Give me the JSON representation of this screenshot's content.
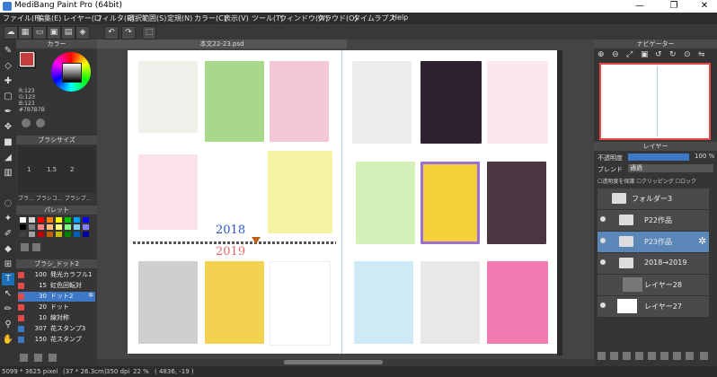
{
  "window": {
    "title": "MediBang Paint Pro (64bit)",
    "min": "—",
    "max": "❐",
    "close": "✕"
  },
  "menu": [
    "ファイル(F)",
    "編集(E)",
    "レイヤー(L)",
    "フィルタ(R)",
    "選択範囲(S)",
    "定規(N)",
    "カラー(C)",
    "表示(V)",
    "ツール(T)",
    "ウィンドウ(W)",
    "クラウド(O)",
    "タイムラプス",
    "Help"
  ],
  "toolbar": {
    "undo": "↶",
    "redo": "↷",
    "deselect": "⬚"
  },
  "panels": {
    "color": {
      "title": "カラー",
      "r": "R:123",
      "g": "G:123",
      "b": "B:123",
      "hex": "#7B7B7B"
    },
    "brush_size": {
      "title": "ブラシサイズ",
      "sizes": [
        "1",
        "1.5",
        "2"
      ],
      "footer": "ブラ… ブラシコ… ブラシプ…"
    },
    "palette": {
      "title": "パレット",
      "colors": [
        "#ffffff",
        "#d8d8d8",
        "#ff0000",
        "#ff8000",
        "#ffff00",
        "#00c000",
        "#00a0ff",
        "#0000ff",
        "#000000",
        "#808080",
        "#ff8080",
        "#ffc080",
        "#ffff80",
        "#80ff80",
        "#80d0ff",
        "#8080ff",
        "#404040",
        "#a0a0a0",
        "#c00000",
        "#c06000",
        "#c0c000",
        "#008000",
        "#0060c0",
        "#0000a0"
      ]
    },
    "brush_dots": {
      "title": "ブラシ_ドット2",
      "items": [
        {
          "size": "100",
          "name": "発光カラフル1"
        },
        {
          "size": "15",
          "name": "虹色回転対"
        },
        {
          "size": "30",
          "name": "ドット2"
        },
        {
          "size": "20",
          "name": "ドット"
        },
        {
          "size": "10",
          "name": "線対称"
        },
        {
          "size": "307",
          "name": "花スタンプ3"
        },
        {
          "size": "150",
          "name": "花スタンプ"
        }
      ]
    }
  },
  "document": {
    "tab": "本文22-23.psd",
    "year_top": "2018",
    "year_bottom": "2019"
  },
  "navigator": {
    "title": "ナビゲーター"
  },
  "layer_panel": {
    "title": "レイヤー",
    "opacity_label": "不透明度",
    "opacity_value": "100 %",
    "blend_label": "ブレンド",
    "blend_value": "通過",
    "protect": "透明度を保護",
    "clipping": "クリッピング",
    "lock": "ロック",
    "layers": [
      {
        "name": "フォルダー3",
        "type": "folder"
      },
      {
        "name": "P22作品",
        "type": "folder"
      },
      {
        "name": "P23作品",
        "type": "folder"
      },
      {
        "name": "2018→2019",
        "type": "folder"
      },
      {
        "name": "レイヤー28",
        "type": "layer"
      },
      {
        "name": "レイヤー27",
        "type": "layer"
      }
    ]
  },
  "status": {
    "size": "5099 * 3625 pixel",
    "physical": "(37 * 26.3cm)",
    "dpi": "350 dpi",
    "zoom": "22 %",
    "coords": "( 4836, -19 )"
  }
}
